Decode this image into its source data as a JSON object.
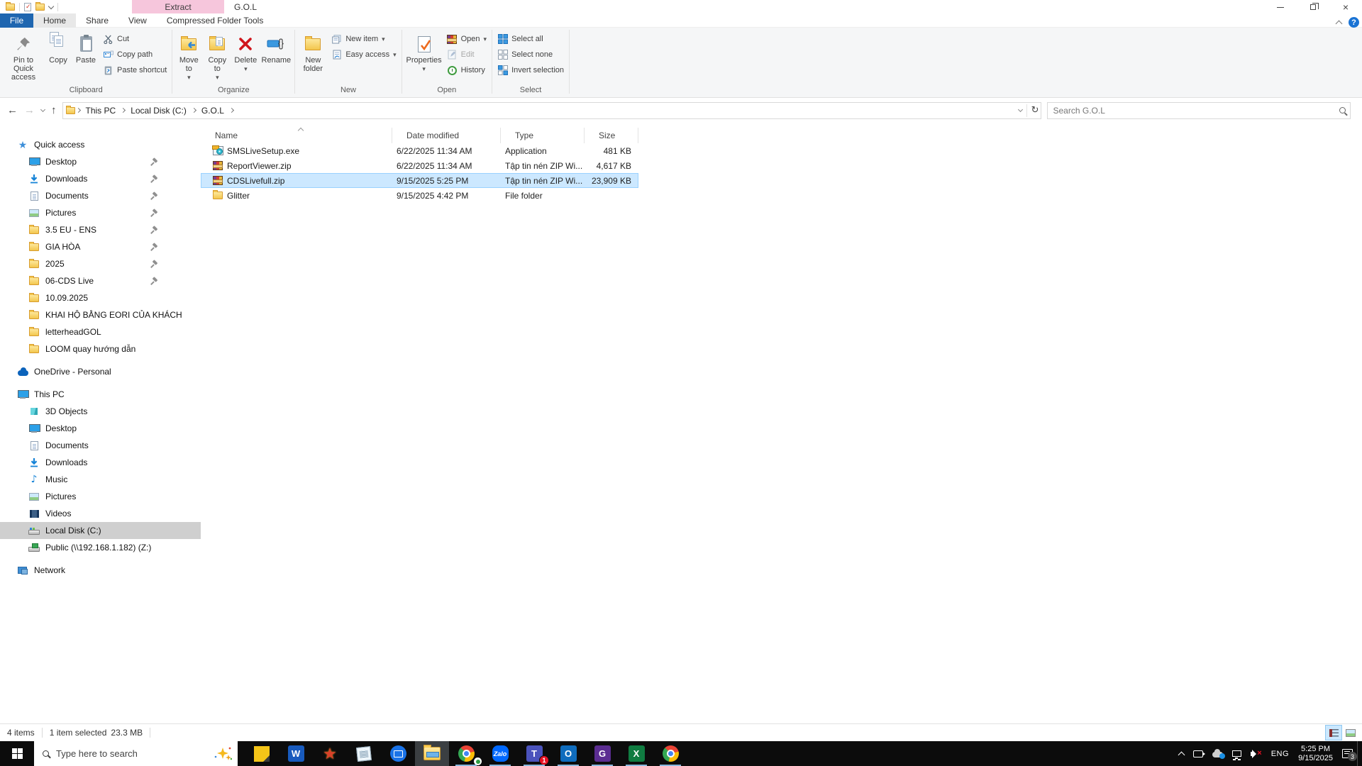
{
  "window": {
    "title": "G.O.L",
    "contextual_header": "Extract"
  },
  "tabs": {
    "file": "File",
    "home": "Home",
    "share": "Share",
    "view": "View",
    "contextual": "Compressed Folder Tools"
  },
  "ribbon": {
    "clipboard": {
      "label": "Clipboard",
      "pin": "Pin to Quick access",
      "copy": "Copy",
      "paste": "Paste",
      "cut": "Cut",
      "copy_path": "Copy path",
      "paste_shortcut": "Paste shortcut"
    },
    "organize": {
      "label": "Organize",
      "move_to": "Move to",
      "copy_to": "Copy to",
      "delete": "Delete",
      "rename": "Rename"
    },
    "new": {
      "label": "New",
      "new_folder": "New folder",
      "new_item": "New item",
      "easy_access": "Easy access"
    },
    "open": {
      "label": "Open",
      "properties": "Properties",
      "open": "Open",
      "edit": "Edit",
      "history": "History"
    },
    "select": {
      "label": "Select",
      "select_all": "Select all",
      "select_none": "Select none",
      "invert": "Invert selection"
    }
  },
  "address": {
    "crumbs": [
      "This PC",
      "Local Disk (C:)",
      "G.O.L"
    ],
    "search_placeholder": "Search G.O.L"
  },
  "sidebar": {
    "quick_access": "Quick access",
    "qa_items": [
      {
        "name": "Desktop",
        "icon": "monitor-icon",
        "pinned": true
      },
      {
        "name": "Downloads",
        "icon": "download-icon",
        "pinned": true
      },
      {
        "name": "Documents",
        "icon": "document-icon",
        "pinned": true
      },
      {
        "name": "Pictures",
        "icon": "picture-icon",
        "pinned": true
      },
      {
        "name": "3.5 EU - ENS",
        "icon": "folder-icon",
        "pinned": true
      },
      {
        "name": "GIA HÒA",
        "icon": "folder-icon",
        "pinned": true
      },
      {
        "name": "2025",
        "icon": "folder-icon",
        "pinned": true
      },
      {
        "name": "06-CDS Live",
        "icon": "folder-icon",
        "pinned": true
      },
      {
        "name": "10.09.2025",
        "icon": "folder-icon",
        "pinned": false
      },
      {
        "name": "KHAI HỘ BẰNG EORI CỦA KHÁCH",
        "icon": "folder-icon",
        "pinned": false
      },
      {
        "name": "letterheadGOL",
        "icon": "folder-icon",
        "pinned": false
      },
      {
        "name": "LOOM quay hướng dẫn",
        "icon": "folder-icon",
        "pinned": false
      }
    ],
    "onedrive": "OneDrive - Personal",
    "this_pc": "This PC",
    "pc_items": [
      {
        "name": "3D Objects",
        "icon": "cube-icon"
      },
      {
        "name": "Desktop",
        "icon": "monitor-icon"
      },
      {
        "name": "Documents",
        "icon": "document-icon"
      },
      {
        "name": "Downloads",
        "icon": "download-icon"
      },
      {
        "name": "Music",
        "icon": "music-icon"
      },
      {
        "name": "Pictures",
        "icon": "picture-icon"
      },
      {
        "name": "Videos",
        "icon": "video-icon"
      },
      {
        "name": "Local Disk (C:)",
        "icon": "drive-icon",
        "selected": true
      },
      {
        "name": "Public (\\\\192.168.1.182) (Z:)",
        "icon": "network-drive-icon"
      }
    ],
    "network": "Network"
  },
  "files": {
    "columns": [
      "Name",
      "Date modified",
      "Type",
      "Size"
    ],
    "rows": [
      {
        "name": "SMSLiveSetup.exe",
        "date": "6/22/2025 11:34 AM",
        "type": "Application",
        "size": "481 KB",
        "icon": "setup-exe-icon",
        "selected": false
      },
      {
        "name": "ReportViewer.zip",
        "date": "6/22/2025 11:34 AM",
        "type": "Tập tin nén ZIP Wi...",
        "size": "4,617 KB",
        "icon": "winrar-zip-icon",
        "selected": false
      },
      {
        "name": "CDSLivefull.zip",
        "date": "9/15/2025 5:25 PM",
        "type": "Tập tin nén ZIP Wi...",
        "size": "23,909 KB",
        "icon": "winrar-zip-icon",
        "selected": true
      },
      {
        "name": "Glitter",
        "date": "9/15/2025 4:42 PM",
        "type": "File folder",
        "size": "",
        "icon": "folder-icon",
        "selected": false
      }
    ]
  },
  "statusbar": {
    "items_count": "4 items",
    "selection": "1 item selected",
    "selection_size": "23.3 MB"
  },
  "taskbar": {
    "search_placeholder": "Type here to search",
    "apps": [
      "sticky-notes",
      "word",
      "ecus-star",
      "notepad",
      "ultraviewer",
      "file-explorer",
      "chrome",
      "zalo",
      "teams",
      "outlook",
      "purple-app",
      "excel",
      "chrome"
    ],
    "logos": {
      "word": "W",
      "zalo": "Zalo",
      "teams": "T",
      "outlook": "O",
      "purple": "G",
      "excel": "X"
    },
    "teams_badge": "1"
  },
  "tray": {
    "lang": "ENG",
    "time": "5:25 PM",
    "date": "9/15/2025",
    "notif_badge": "3"
  }
}
